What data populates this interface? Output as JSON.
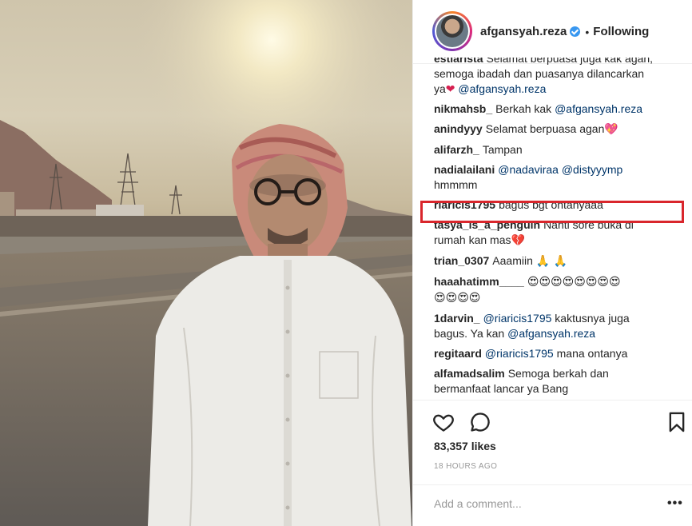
{
  "header": {
    "username": "afgansyah.reza",
    "separator": "•",
    "follow_status": "Following"
  },
  "comments": [
    {
      "user": "estiarista",
      "parts": [
        {
          "t": "Selamat berpuasa juga kak agan,"
        }
      ]
    },
    {
      "user": "",
      "parts": [
        {
          "t": "semoga ibadah dan puasanya dilancarkan"
        }
      ]
    },
    {
      "user": "",
      "parts": [
        {
          "t": "ya"
        },
        {
          "t": "❤",
          "cls": "heart"
        },
        {
          "t": " "
        },
        {
          "t": "@afgansyah.reza",
          "cls": "mention"
        }
      ]
    },
    {
      "user": "nikmahsb_",
      "parts": [
        {
          "t": "Berkah kak "
        },
        {
          "t": "@afgansyah.reza",
          "cls": "mention"
        }
      ]
    },
    {
      "user": "anindyyy",
      "parts": [
        {
          "t": "Selamat berpuasa agan"
        },
        {
          "t": "💖",
          "cls": "heart emo"
        }
      ]
    },
    {
      "user": "alifarzh_",
      "parts": [
        {
          "t": "Tampan"
        }
      ]
    },
    {
      "user": "nadialailani",
      "parts": [
        {
          "t": "@nadaviraa",
          "cls": "mention"
        },
        {
          "t": " "
        },
        {
          "t": "@distyyymp",
          "cls": "mention"
        }
      ]
    },
    {
      "user": "",
      "parts": [
        {
          "t": "hmmmm"
        }
      ]
    },
    {
      "user": "riaricis1795",
      "parts": [
        {
          "t": "bagus bgt ontanyaaa"
        }
      ]
    },
    {
      "user": "tasya_is_a_penguin",
      "parts": [
        {
          "t": "Nanti sore buka di"
        }
      ]
    },
    {
      "user": "",
      "parts": [
        {
          "t": "rumah kan mas"
        },
        {
          "t": "💔",
          "cls": "heart emo"
        }
      ]
    },
    {
      "user": "trian_0307",
      "parts": [
        {
          "t": "Aaamiin "
        },
        {
          "t": "🙏 🙏",
          "cls": "emo"
        }
      ]
    },
    {
      "user": "haaahatimm____",
      "parts": [
        {
          "t": "😍😍😍😍😍😍😍😍",
          "cls": "emo"
        }
      ]
    },
    {
      "user": "",
      "parts": [
        {
          "t": "😍😍😍😍",
          "cls": "emo"
        }
      ]
    },
    {
      "user": "1darvin_",
      "parts": [
        {
          "t": "@riaricis1795",
          "cls": "mention"
        },
        {
          "t": " kaktusnya juga"
        }
      ]
    },
    {
      "user": "",
      "parts": [
        {
          "t": "bagus. Ya kan "
        },
        {
          "t": "@afgansyah.reza",
          "cls": "mention"
        }
      ]
    },
    {
      "user": "regitaard",
      "parts": [
        {
          "t": "@riaricis1795",
          "cls": "mention"
        },
        {
          "t": " mana ontanya"
        }
      ]
    },
    {
      "user": "alfamadsalim",
      "parts": [
        {
          "t": "Semoga berkah dan"
        }
      ]
    },
    {
      "user": "",
      "parts": [
        {
          "t": "bermanfaat lancar ya Bang"
        }
      ]
    }
  ],
  "actions": {
    "like_icon": "heart-outline-icon",
    "comment_icon": "speech-bubble-icon",
    "save_icon": "bookmark-icon",
    "likes": "83,357 likes",
    "time": "18 HOURS AGO"
  },
  "add_comment": {
    "placeholder": "Add a comment...",
    "more": "•••"
  },
  "colors": {
    "mention": "#003569",
    "highlight_box": "#d9262c",
    "verified": "#3897f0"
  }
}
